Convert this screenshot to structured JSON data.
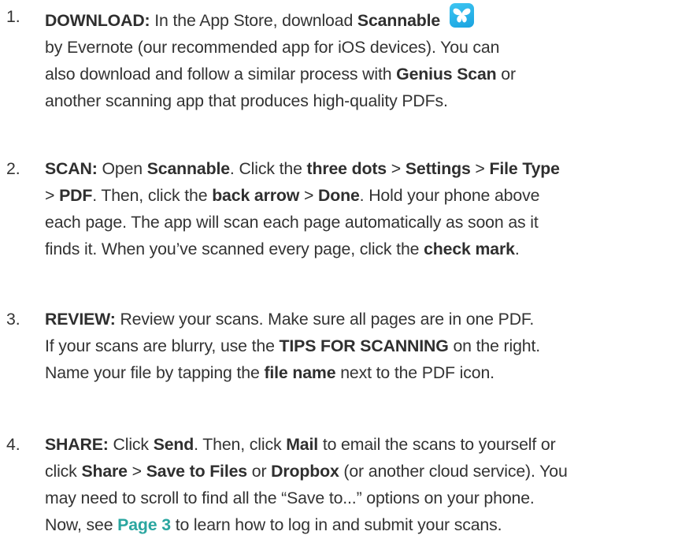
{
  "steps": [
    {
      "number": "1.",
      "segments": [
        {
          "text": "DOWNLOAD:",
          "b": true
        },
        {
          "text": " In the App Store, download "
        },
        {
          "text": "Scannable",
          "b": true
        },
        {
          "icon": "scannable-app-icon"
        },
        {
          "br": true
        },
        {
          "text": "by Evernote (our recommended app for iOS devices). You can"
        },
        {
          "br": true
        },
        {
          "text": "also download and follow a similar process with "
        },
        {
          "text": "Genius Scan",
          "b": true
        },
        {
          "text": " or"
        },
        {
          "br": true
        },
        {
          "text": "another scanning app that produces high-quality PDFs."
        }
      ]
    },
    {
      "number": "2.",
      "segments": [
        {
          "text": "SCAN:",
          "b": true
        },
        {
          "text": " Open "
        },
        {
          "text": "Scannable",
          "b": true
        },
        {
          "text": ". Click the "
        },
        {
          "text": "three dots",
          "b": true
        },
        {
          "text": " > "
        },
        {
          "text": "Settings",
          "b": true
        },
        {
          "text": " > "
        },
        {
          "text": "File Type",
          "b": true
        },
        {
          "br": true
        },
        {
          "text": "> "
        },
        {
          "text": "PDF",
          "b": true
        },
        {
          "text": ". Then, click the "
        },
        {
          "text": "back arrow",
          "b": true
        },
        {
          "text": " > "
        },
        {
          "text": "Done",
          "b": true
        },
        {
          "text": ". Hold your phone above"
        },
        {
          "br": true
        },
        {
          "text": "each page. The app will scan each page automatically as soon as it"
        },
        {
          "br": true
        },
        {
          "text": "finds it. When you’ve scanned every page, click the "
        },
        {
          "text": "check mark",
          "b": true
        },
        {
          "text": "."
        }
      ]
    },
    {
      "number": "3.",
      "segments": [
        {
          "text": "REVIEW:",
          "b": true
        },
        {
          "text": " Review your scans. Make sure all pages are in one PDF."
        },
        {
          "br": true
        },
        {
          "text": "If your scans are blurry, use the "
        },
        {
          "text": "TIPS FOR SCANNING",
          "b": true
        },
        {
          "text": " on the right."
        },
        {
          "br": true
        },
        {
          "text": "Name your file by tapping the "
        },
        {
          "text": "file name",
          "b": true
        },
        {
          "text": " next to the PDF icon."
        }
      ]
    },
    {
      "number": "4.",
      "segments": [
        {
          "text": "SHARE:",
          "b": true
        },
        {
          "text": " Click "
        },
        {
          "text": "Send",
          "b": true
        },
        {
          "text": ". Then, click "
        },
        {
          "text": "Mail",
          "b": true
        },
        {
          "text": " to email the scans to yourself or"
        },
        {
          "br": true
        },
        {
          "text": "click "
        },
        {
          "text": "Share",
          "b": true
        },
        {
          "text": " > "
        },
        {
          "text": "Save to Files",
          "b": true
        },
        {
          "text": " or "
        },
        {
          "text": "Dropbox",
          "b": true
        },
        {
          "text": " (or another cloud service). You"
        },
        {
          "br": true
        },
        {
          "text": "may need to scroll to find all the “Save to...” options on your phone."
        },
        {
          "br": true
        },
        {
          "text": "Now, see "
        },
        {
          "text": "Page 3",
          "link": true
        },
        {
          "text": " to learn how to log in and submit your scans."
        }
      ]
    }
  ],
  "colors": {
    "text": "#333333",
    "link": "#2aa6a0",
    "icon_top": "#3ec6f2",
    "icon_bottom": "#1aa3e0"
  }
}
